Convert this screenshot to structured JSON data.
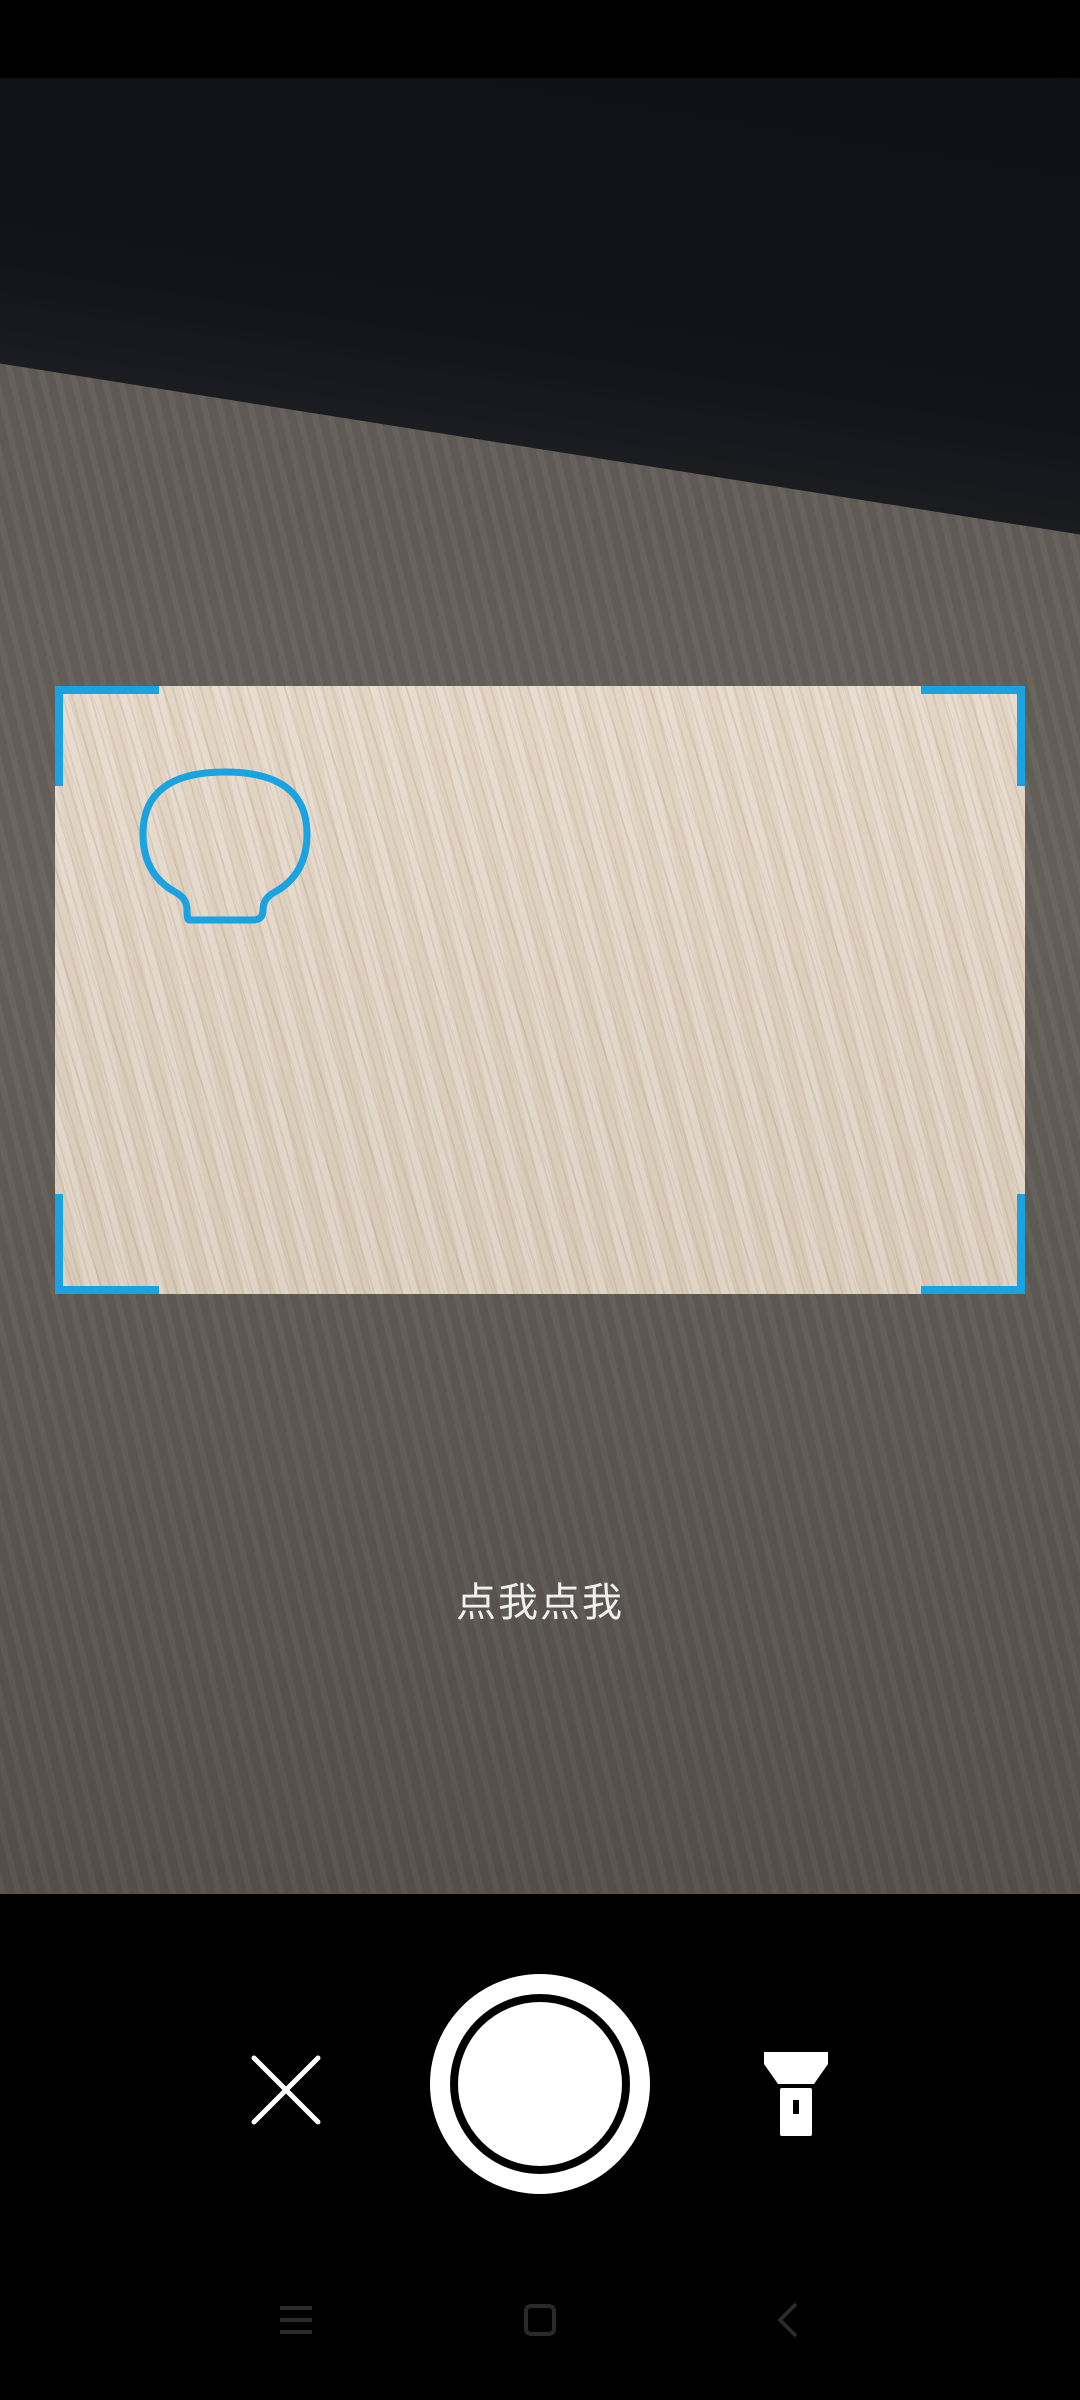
{
  "scanner": {
    "hint_text": "点我点我",
    "frame_color": "#19a3e0"
  },
  "controls": {
    "close_icon": "close-icon",
    "shutter_icon": "shutter-icon",
    "flashlight_icon": "flashlight-icon"
  },
  "nav": {
    "menu_icon": "menu-icon",
    "home_icon": "home-icon",
    "back_icon": "back-icon"
  }
}
